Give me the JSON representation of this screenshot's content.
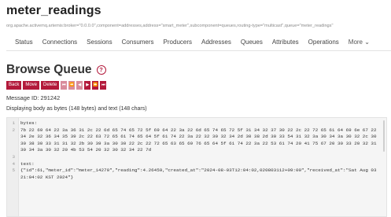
{
  "page": {
    "title": "meter_readings",
    "mbean": "org.apache.activemq.artemis:broker=\"0.0.0.0\",component=addresses,address=\"smart_meter\",subcomponent=queues,routing-type=\"multicast\",queue=\"meter_readings\""
  },
  "tabs": [
    {
      "label": "Status"
    },
    {
      "label": "Connections"
    },
    {
      "label": "Sessions"
    },
    {
      "label": "Consumers"
    },
    {
      "label": "Producers"
    },
    {
      "label": "Addresses"
    },
    {
      "label": "Queues"
    },
    {
      "label": "Attributes"
    },
    {
      "label": "Operations"
    },
    {
      "label": "More ⌄"
    }
  ],
  "browse": {
    "heading": "Browse Queue",
    "help_icon": "question-circle-icon",
    "buttons": {
      "back": "Back",
      "move": "Move",
      "delete": "Delete"
    },
    "nav": {
      "first": "⏮",
      "prev_fast": "⏪",
      "prev": "◀",
      "next": "▶",
      "next_page": "⏩",
      "last": "⏭"
    },
    "message_id": "Message ID: 291242",
    "display_info": "Displaying body as bytes (148 bytes) and text (148 chars)"
  },
  "code_lines": [
    {
      "n": "1",
      "text": "bytes:"
    },
    {
      "n": "2",
      "text": "7b 22 69 64 22 3a 36 31 2c 22 6d 65 74 65 72 5f 69 64 22 3a 22 6d 65 74 65 72 5f 31 34 32 37 30 22 2c 22 72 65 61 64 69 6e 67 22"
    },
    {
      "n": "",
      "text": "34 2e 32 36 34 35 39 2c 22 63 72 65 61 74 65 64 5f 61 74 22 3a 22 32 30 32 34 2d 30 38 2d 30 33 54 31 32 3a 30 34 3a 30 32 2c 30"
    },
    {
      "n": "",
      "text": "30 38 30 33 31 31 32 2b 30 39 3a 30 30 22 2c 22 72 65 63 65 69 76 65 64 5f 61 74 22 3a 22 53 61 74 20 41 75 67 20 30 33 20 32 31"
    },
    {
      "n": "",
      "text": "30 34 3a 30 32 20 4b 53 54 20 32 30 32 34 22 7d"
    },
    {
      "n": "3",
      "text": ""
    },
    {
      "n": "4",
      "text": "text:"
    },
    {
      "n": "5",
      "text": "{\"id\":61,\"meter_id\":\"meter_14270\",\"reading\":4.26459,\"created_at\":\"2024-08-03T12:04:02,020803112+09:00\",\"received_at\":\"Sat Aug 03"
    },
    {
      "n": "",
      "text": "21:04:02 KST 2024\"}"
    }
  ],
  "colors": {
    "accent": "#b3193b"
  }
}
